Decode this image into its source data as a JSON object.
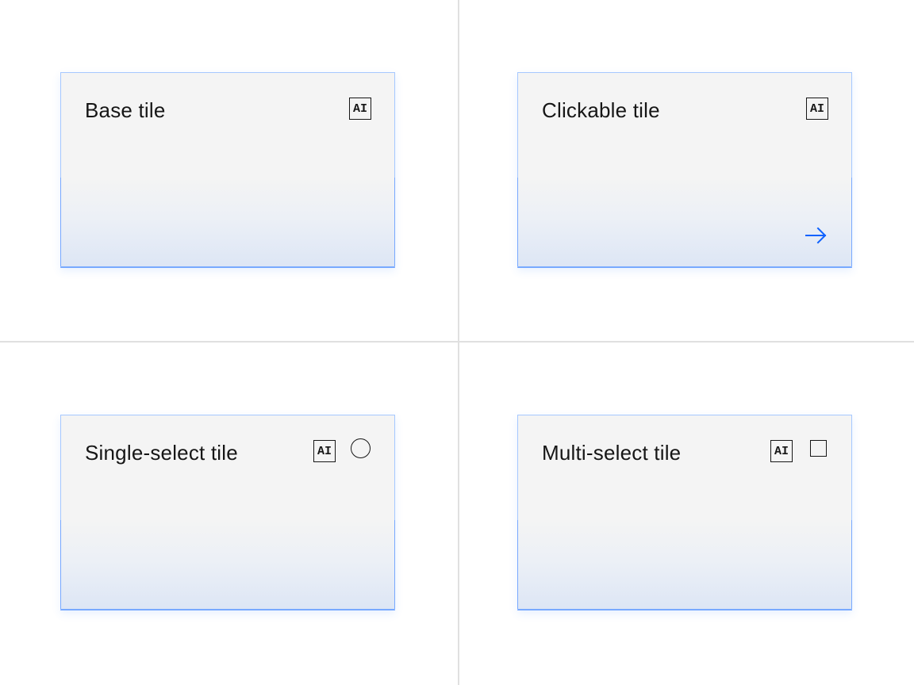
{
  "tiles": {
    "base": {
      "title": "Base tile",
      "ai_label": "AI"
    },
    "clickable": {
      "title": "Clickable tile",
      "ai_label": "AI",
      "action_icon": "arrow-right-icon"
    },
    "single_select": {
      "title": "Single-select tile",
      "ai_label": "AI",
      "selected": false,
      "control_icon": "radio-button-icon"
    },
    "multi_select": {
      "title": "Multi-select tile",
      "ai_label": "AI",
      "checked": false,
      "control_icon": "checkbox-icon"
    }
  },
  "colors": {
    "accent": "#0f62fe",
    "tile_border": "#a6c8ff",
    "tile_bottom_border": "#78a9ff",
    "tile_background": "#f4f4f4",
    "divider": "#e0e0e0",
    "text": "#161616"
  }
}
